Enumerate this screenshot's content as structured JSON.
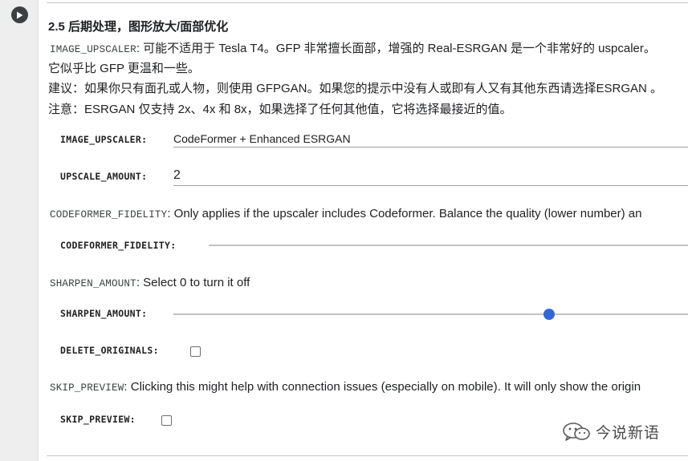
{
  "colors": {
    "slider_thumb": "#3367d6",
    "gutter": "#eeeeee",
    "text": "#202124"
  },
  "cell": {
    "run_icon": "play-circle-icon",
    "title": "2.5 后期处理，图形放大/面部优化",
    "intro": {
      "code": "IMAGE_UPSCALER",
      "line1": ": 可能不适用于 Tesla T4。GFP 非常擅长面部，增强的 Real-ESRGAN 是一个非常好的 uspcaler。",
      "line2": "它似乎比 GFP 更温和一些。",
      "line3": "建议：如果你只有面孔或人物，则使用 GFPGAN。如果您的提示中没有人或即有人又有其他东西请选择ESRGAN 。",
      "line4": "注意：ESRGAN 仅支持 2x、4x 和 8x，如果选择了任何其他值，它将选择最接近的值。"
    },
    "image_upscaler": {
      "label": "IMAGE_UPSCALER:",
      "value": "CodeFormer + Enhanced ESRGAN"
    },
    "upscale_amount": {
      "label": "UPSCALE_AMOUNT:",
      "value": "2"
    },
    "codeformer_note": {
      "code": "CODEFORMER_FIDELITY",
      "text": ": Only applies if the upscaler includes Codeformer. Balance the quality (lower number) an"
    },
    "codeformer_fidelity": {
      "label": "CODEFORMER_FIDELITY:"
    },
    "sharpen_note": {
      "code": "SHARPEN_AMOUNT",
      "text": ": Select 0 to turn it off"
    },
    "sharpen_amount": {
      "label": "SHARPEN_AMOUNT:",
      "level_fraction": 0.73
    },
    "delete_originals": {
      "label": "DELETE_ORIGINALS:",
      "checked": false
    },
    "skip_note": {
      "code": "SKIP_PREVIEW",
      "text": ": Clicking this might help with connection issues (especially on mobile). It will only show the origin"
    },
    "skip_preview": {
      "label": "SKIP_PREVIEW:",
      "checked": false
    }
  },
  "watermark": {
    "icon": "wechat-icon",
    "text": "今说新语"
  }
}
